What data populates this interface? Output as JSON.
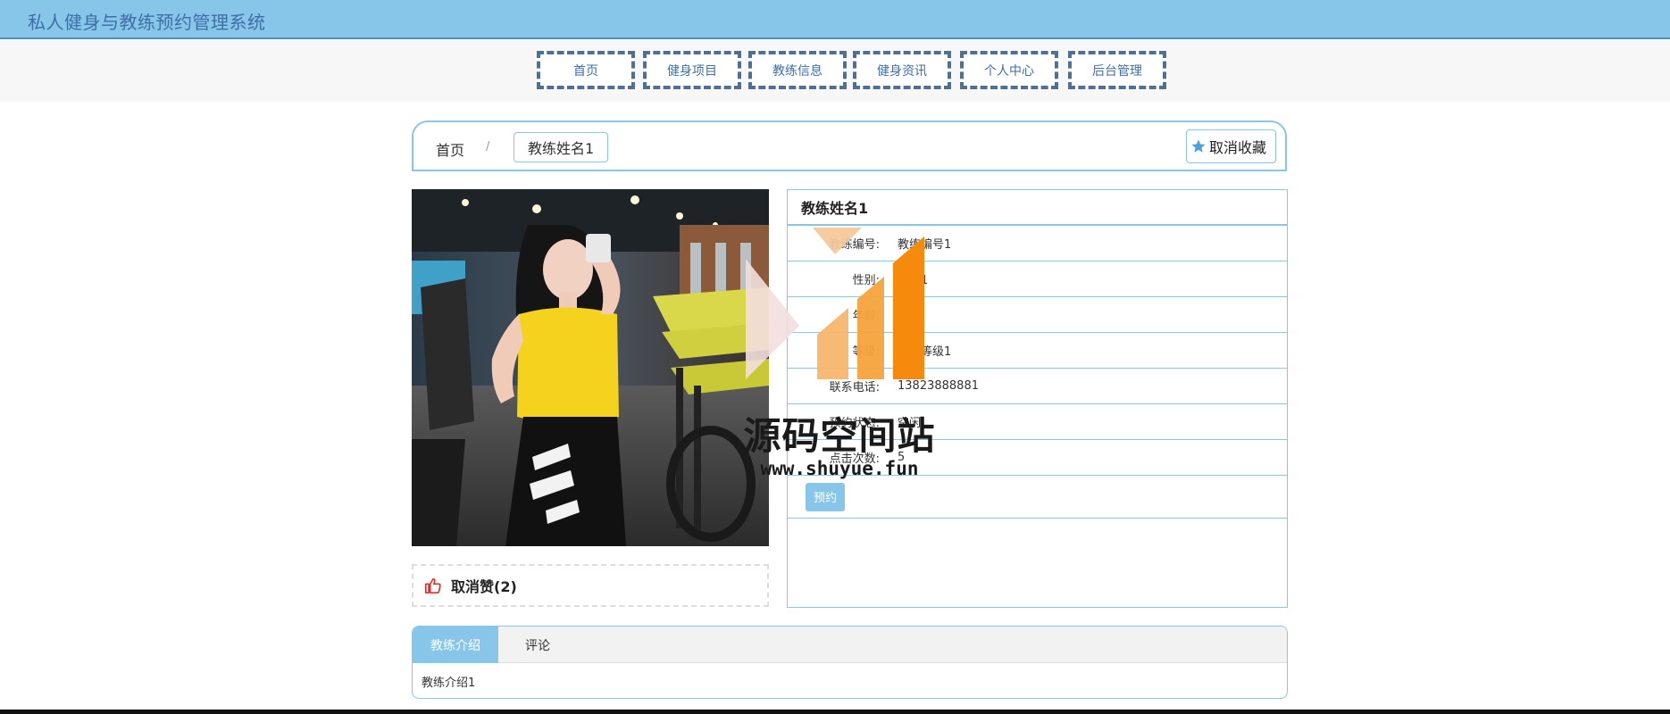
{
  "app": {
    "title": "私人健身与教练预约管理系统"
  },
  "nav": {
    "items": [
      {
        "label": "首页"
      },
      {
        "label": "健身项目"
      },
      {
        "label": "教练信息"
      },
      {
        "label": "健身资讯"
      },
      {
        "label": "个人中心"
      },
      {
        "label": "后台管理"
      }
    ]
  },
  "breadcrumb": {
    "home": "首页",
    "separator": "/",
    "current": "教练姓名1",
    "favorite_label": "取消收藏"
  },
  "like": {
    "label": "取消赞(2)"
  },
  "detail": {
    "title": "教练姓名1",
    "fields": [
      {
        "label": "教练编号:",
        "value": "教练编号1"
      },
      {
        "label": "性别:",
        "value": "性别1"
      },
      {
        "label": "年龄:",
        "value": ""
      },
      {
        "label": "等级:",
        "value": "教练等级1"
      },
      {
        "label": "联系电话:",
        "value": "13823888881"
      },
      {
        "label": "预约状态:",
        "value": "空闲"
      },
      {
        "label": "点击次数:",
        "value": "5"
      }
    ],
    "book_label": "预约"
  },
  "tabs": {
    "items": [
      {
        "label": "教练介绍"
      },
      {
        "label": "评论"
      }
    ],
    "active_index": 0,
    "content": "教练介绍1"
  },
  "watermark": {
    "text": "源码空间站",
    "url": "www.shuyue.fun"
  },
  "colors": {
    "accent": "#87c6e8",
    "title_text": "#3f6ea8",
    "nav_border": "#4f6f94",
    "like_icon": "#e0302a",
    "star_icon": "#4aa3df"
  }
}
